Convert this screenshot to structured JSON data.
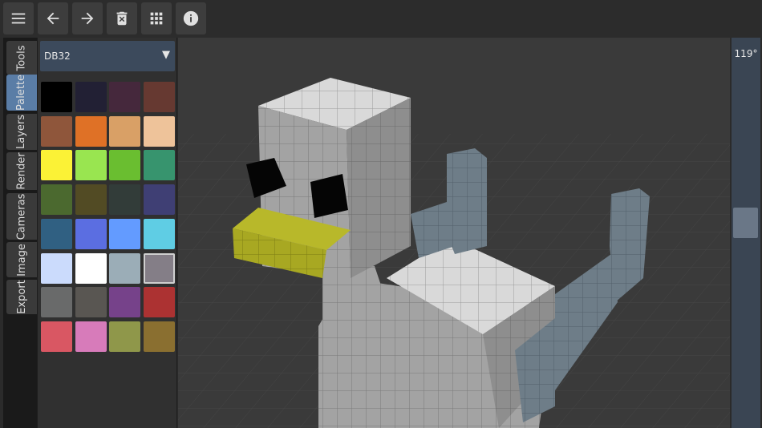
{
  "toolbar": {
    "buttons": [
      {
        "name": "menu-button",
        "icon": "hamburger-icon"
      },
      {
        "name": "undo-button",
        "icon": "arrow-left-icon"
      },
      {
        "name": "redo-button",
        "icon": "arrow-right-icon"
      },
      {
        "name": "delete-button",
        "icon": "trash-icon"
      },
      {
        "name": "grid-button",
        "icon": "grid-icon"
      },
      {
        "name": "info-button",
        "icon": "info-icon"
      }
    ]
  },
  "tabs": [
    "Tools",
    "Palette",
    "Layers",
    "Render",
    "Cameras",
    "Image",
    "Export"
  ],
  "active_tab": "Palette",
  "palette": {
    "name": "DB32",
    "colors": [
      "#000000",
      "#222034",
      "#45283c",
      "#663931",
      "#8f563b",
      "#df7126",
      "#d9a066",
      "#eec39a",
      "#fbf236",
      "#99e550",
      "#6abe30",
      "#37946e",
      "#4b692f",
      "#524b24",
      "#323c39",
      "#3f3f74",
      "#306082",
      "#5b6ee1",
      "#639bff",
      "#5fcde4",
      "#cbdbfc",
      "#ffffff",
      "#9badb7",
      "#847e87",
      "#696a6a",
      "#595652",
      "#76428a",
      "#ac3232",
      "#d95763",
      "#d77bba",
      "#8f974a",
      "#8a6f30"
    ],
    "selected_index": 23
  },
  "camera": {
    "angle_label": "119°"
  },
  "colors": {
    "accent": "#5a7da6",
    "toolbar_bg": "#2c2c2c",
    "viewport_bg": "#3a3a3a"
  }
}
